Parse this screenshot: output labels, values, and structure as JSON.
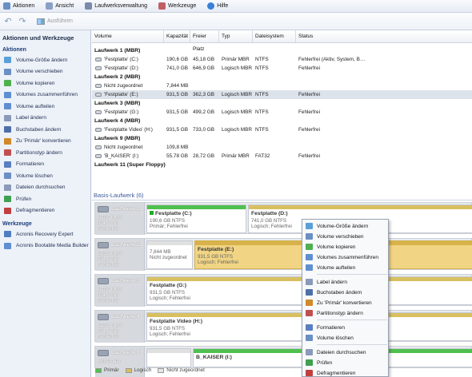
{
  "menu": [
    "Aktionen",
    "Ansicht",
    "Laufwerksverwaltung",
    "Werkzeuge",
    "Hilfe"
  ],
  "toolbar": {
    "run_label": "Ausführen"
  },
  "sidebar": {
    "title": "Aktionen und Werkzeuge",
    "actions_header": "Aktionen",
    "actions": [
      {
        "label": "Volume-Größe ändern",
        "color": "#5aa0d8"
      },
      {
        "label": "Volume verschieben",
        "color": "#6a8fc4"
      },
      {
        "label": "Volume kopieren",
        "color": "#4fb04f"
      },
      {
        "label": "Volumes zusammenführen",
        "color": "#5f8fd0"
      },
      {
        "label": "Volume aufteilen",
        "color": "#5f8fd0"
      },
      {
        "label": "Label ändern",
        "color": "#8a9ab8"
      },
      {
        "label": "Buchstaben ändern",
        "color": "#4d6fa8"
      },
      {
        "label": "Zu 'Primär' konvertieren",
        "color": "#d08a2a"
      },
      {
        "label": "Partitionstyp ändern",
        "color": "#c05050"
      },
      {
        "label": "Formatieren",
        "color": "#5a7fc0"
      },
      {
        "label": "Volume löschen",
        "color": "#6a8fc4"
      },
      {
        "label": "Dateien durchsuchen",
        "color": "#8a9ab8"
      },
      {
        "label": "Prüfen",
        "color": "#3fa050"
      },
      {
        "label": "Defragmentieren",
        "color": "#c04040"
      }
    ],
    "tools_header": "Werkzeuge",
    "tools": [
      {
        "label": "Acronis Recovery Expert",
        "color": "#4f7fc0"
      },
      {
        "label": "Acronis Bootable Media Builder",
        "color": "#5f8fd0"
      }
    ]
  },
  "table": {
    "headers": [
      "Volume",
      "Kapazität",
      "Freier Platz",
      "Typ",
      "Dateisystem",
      "Status"
    ],
    "rows": [
      {
        "group": true,
        "volume": "Laufwerk 1 (MBR)"
      },
      {
        "volume": "'Festplatte' (C:)",
        "cap": "190,6 GB",
        "free": "45,18 GB",
        "type": "Primär MBR",
        "fs": "NTFS",
        "status": "Fehlerfrei (Aktiv, System, B…"
      },
      {
        "volume": "'Festplatte' (D:)",
        "cap": "741,0 GB",
        "free": "646,9 GB",
        "type": "Logisch MBR",
        "fs": "NTFS",
        "status": "Fehlerfrei"
      },
      {
        "group": true,
        "volume": "Laufwerk 2 (MBR)"
      },
      {
        "volume": "Nicht zugeordnet",
        "cap": "7,844 MB",
        "free": "",
        "type": "",
        "fs": "",
        "status": ""
      },
      {
        "volume": "'Festplatte' (E:)",
        "cap": "931,5 GB",
        "free": "362,3 GB",
        "type": "Logisch MBR",
        "fs": "NTFS",
        "status": "Fehlerfrei",
        "selected": true
      },
      {
        "group": true,
        "volume": "Laufwerk 3 (MBR)"
      },
      {
        "volume": "'Festplatte' (G:)",
        "cap": "931,5 GB",
        "free": "499,2 GB",
        "type": "Logisch MBR",
        "fs": "NTFS",
        "status": "Fehlerfrei"
      },
      {
        "group": true,
        "volume": "Laufwerk 4 (MBR)"
      },
      {
        "volume": "'Festplatte Video' (H:)",
        "cap": "931,5 GB",
        "free": "733,0 GB",
        "type": "Logisch MBR",
        "fs": "NTFS",
        "status": "Fehlerfrei"
      },
      {
        "group": true,
        "volume": "Laufwerk 9 (MBR)"
      },
      {
        "volume": "Nicht zugeordnet",
        "cap": "109,8 MB",
        "free": "",
        "type": "",
        "fs": "",
        "status": ""
      },
      {
        "volume": "'B_KAISER' (I:)",
        "cap": "55,78 GB",
        "free": "28,72 GB",
        "type": "Primär MBR",
        "fs": "FAT32",
        "status": "Fehlerfrei"
      },
      {
        "group": true,
        "volume": "Laufwerk 11 (Super Floppy)"
      }
    ]
  },
  "basic_title": "Basis-Laufwerk (6)",
  "disks": [
    {
      "name": "Laufwerk 1",
      "l1": "Basis MBR",
      "l2": "931,5 GB",
      "l3": "Fehlerfrei",
      "parts": [
        {
          "name": "Festplatte (C:)",
          "l1": "190,6 GB NTFS",
          "l2": "Primär; Fehlerfrei",
          "bar": "#4fc04f",
          "check": true
        },
        {
          "name": "Festplatte (D:)",
          "l1": "741,0 GB NTFS",
          "l2": "Logisch; Fehlerfrei",
          "bar": "#d8c060"
        }
      ]
    },
    {
      "name": "Laufwerk 2",
      "l1": "Basis MBR",
      "l2": "931,5 GB",
      "l3": "Fehlerfrei",
      "parts": [
        {
          "name": "",
          "l1": "7,844 MB",
          "l2": "Nicht zugeordnet",
          "bar": "#e0e0e0"
        },
        {
          "name": "Festplatte (E:)",
          "l1": "931,5 GB NTFS",
          "l2": "Logisch; Fehlerfrei",
          "bar": "#d8b24a",
          "selected": true
        }
      ]
    },
    {
      "name": "Laufwerk 3",
      "l1": "Basis MBR",
      "l2": "931,5 GB",
      "l3": "Fehlerfrei",
      "parts": [
        {
          "name": "Festplatte (G:)",
          "l1": "931,5 GB NTFS",
          "l2": "Logisch; Fehlerfrei",
          "bar": "#d8c060"
        }
      ]
    },
    {
      "name": "Laufwerk 4",
      "l1": "Basis MBR",
      "l2": "931,5 GB",
      "l3": "Fehlerfrei",
      "parts": [
        {
          "name": "Festplatte Video (H:)",
          "l1": "931,5 GB NTFS",
          "l2": "Logisch; Fehlerfrei",
          "bar": "#d8c060"
        }
      ]
    },
    {
      "name": "Laufwerk 9",
      "l1": "Entfernbar",
      "l2": "",
      "l3": "",
      "parts": [
        {
          "name": "",
          "l1": "",
          "l2": "",
          "bar": "#e0e0e0"
        },
        {
          "name": "B_KAISER (I:)",
          "l1": "",
          "l2": "",
          "bar": "#4fc04f"
        }
      ]
    }
  ],
  "legend": [
    "Primär",
    "Logisch",
    "Nicht zugeordnet"
  ],
  "context_menu": [
    {
      "label": "Volume-Größe ändern",
      "color": "#5aa0d8"
    },
    {
      "label": "Volume verschieben",
      "color": "#6a8fc4"
    },
    {
      "label": "Volume kopieren",
      "color": "#4fb04f"
    },
    {
      "label": "Volumes zusammenführen",
      "color": "#5f8fd0"
    },
    {
      "label": "Volume aufteilen",
      "color": "#5f8fd0"
    },
    {
      "label": "Label ändern",
      "color": "#8a9ab8"
    },
    {
      "label": "Buchstaben ändern",
      "color": "#4d6fa8"
    },
    {
      "label": "Zu 'Primär' konvertieren",
      "color": "#d08a2a"
    },
    {
      "label": "Partitionstyp ändern",
      "color": "#c05050"
    },
    {
      "label": "Formatieren",
      "color": "#5a7fc0"
    },
    {
      "label": "Volume löschen",
      "color": "#6a8fc4"
    },
    {
      "label": "Dateien durchsuchen",
      "color": "#8a9ab8"
    },
    {
      "label": "Prüfen",
      "color": "#3fa050"
    },
    {
      "label": "Defragmentieren",
      "color": "#c04040"
    }
  ]
}
